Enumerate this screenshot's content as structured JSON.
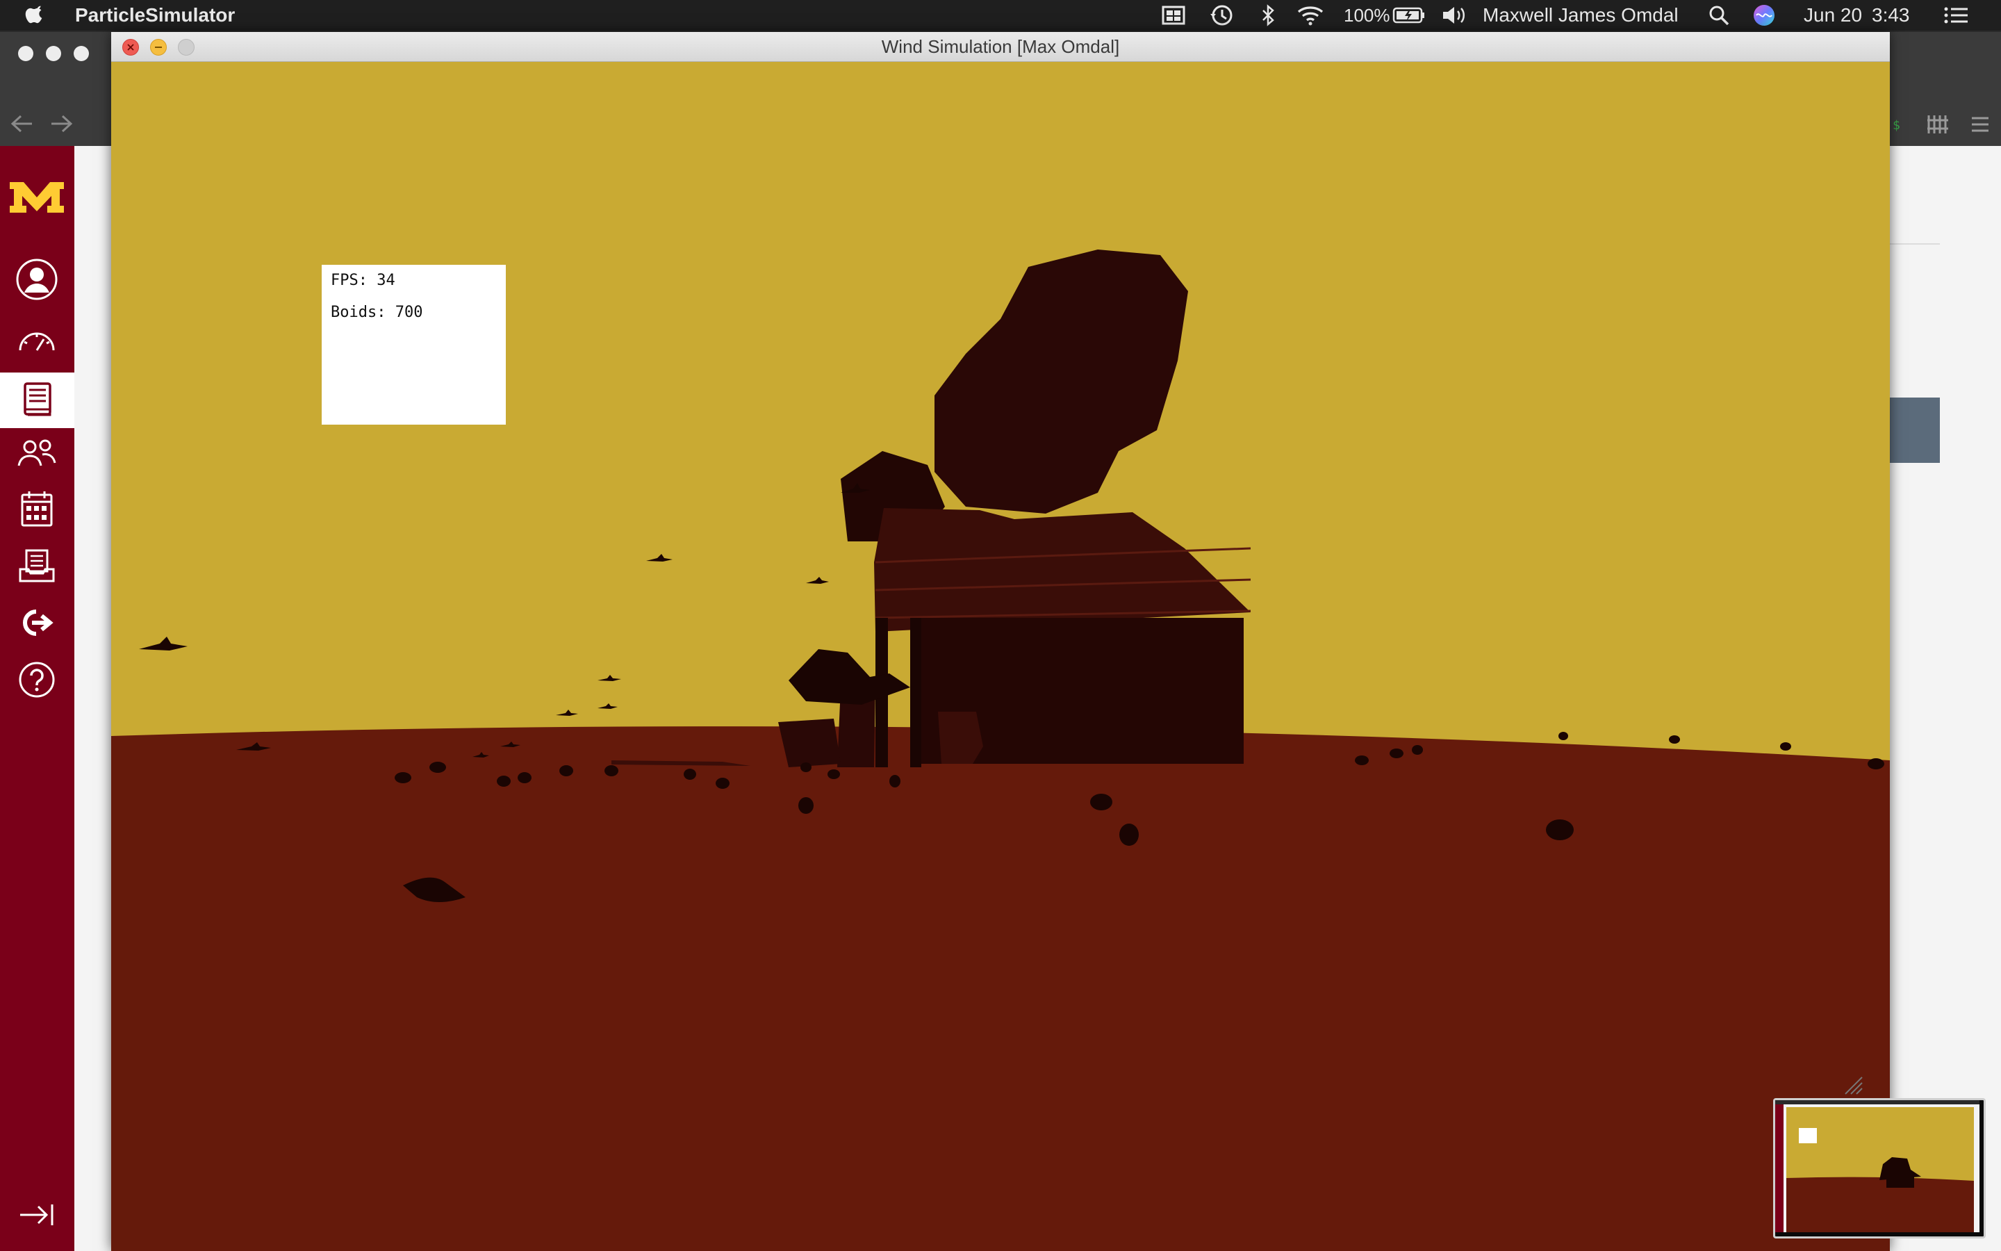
{
  "menubar": {
    "app_name": "ParticleSimulator",
    "battery": "100%",
    "user": "Maxwell James Omdal",
    "date": "Jun 20",
    "time": "3:43",
    "icons": [
      "apple-icon",
      "mission-control-icon",
      "time-machine-icon",
      "bluetooth-icon",
      "wifi-icon",
      "battery-icon",
      "volume-icon",
      "spotlight-icon",
      "siri-icon",
      "notification-center-icon"
    ]
  },
  "window": {
    "title": "Wind Simulation [Max Omdal]"
  },
  "hud": {
    "fps": "FPS: 34",
    "boids": "Boids: 700"
  },
  "sidebar": {
    "logo": "M",
    "items": [
      "account-icon",
      "dashboard-icon",
      "courses-icon",
      "groups-icon",
      "calendar-icon",
      "inbox-icon",
      "commons-icon",
      "help-icon"
    ],
    "active_index": 2,
    "collapse_icon": "collapse-icon"
  },
  "colors": {
    "sky": "#c9aa33",
    "ground": "#651a0b",
    "silhouette": "#1a0503",
    "canvas_brand": "#7a0019",
    "canvas_gold": "#ffcc33"
  }
}
